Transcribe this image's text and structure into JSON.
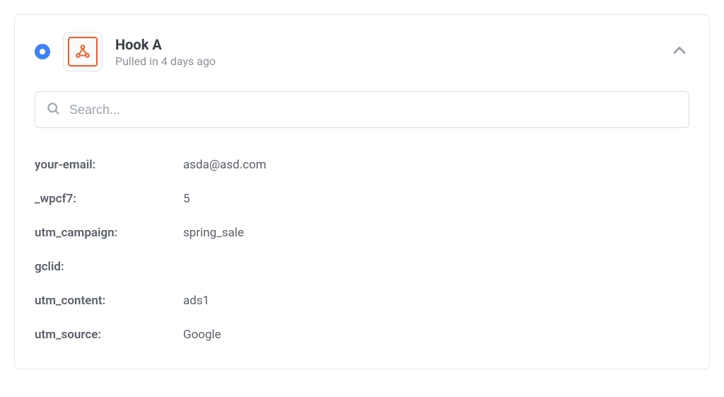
{
  "header": {
    "title": "Hook A",
    "subtitle": "Pulled in 4 days ago"
  },
  "search": {
    "placeholder": "Search...",
    "value": ""
  },
  "fields": [
    {
      "key": "your-email:",
      "value": "asda@asd.com"
    },
    {
      "key": "_wpcf7:",
      "value": "5"
    },
    {
      "key": "utm_campaign:",
      "value": "spring_sale"
    },
    {
      "key": "gclid:",
      "value": ""
    },
    {
      "key": "utm_content:",
      "value": "ads1"
    },
    {
      "key": "utm_source:",
      "value": "Google"
    }
  ]
}
